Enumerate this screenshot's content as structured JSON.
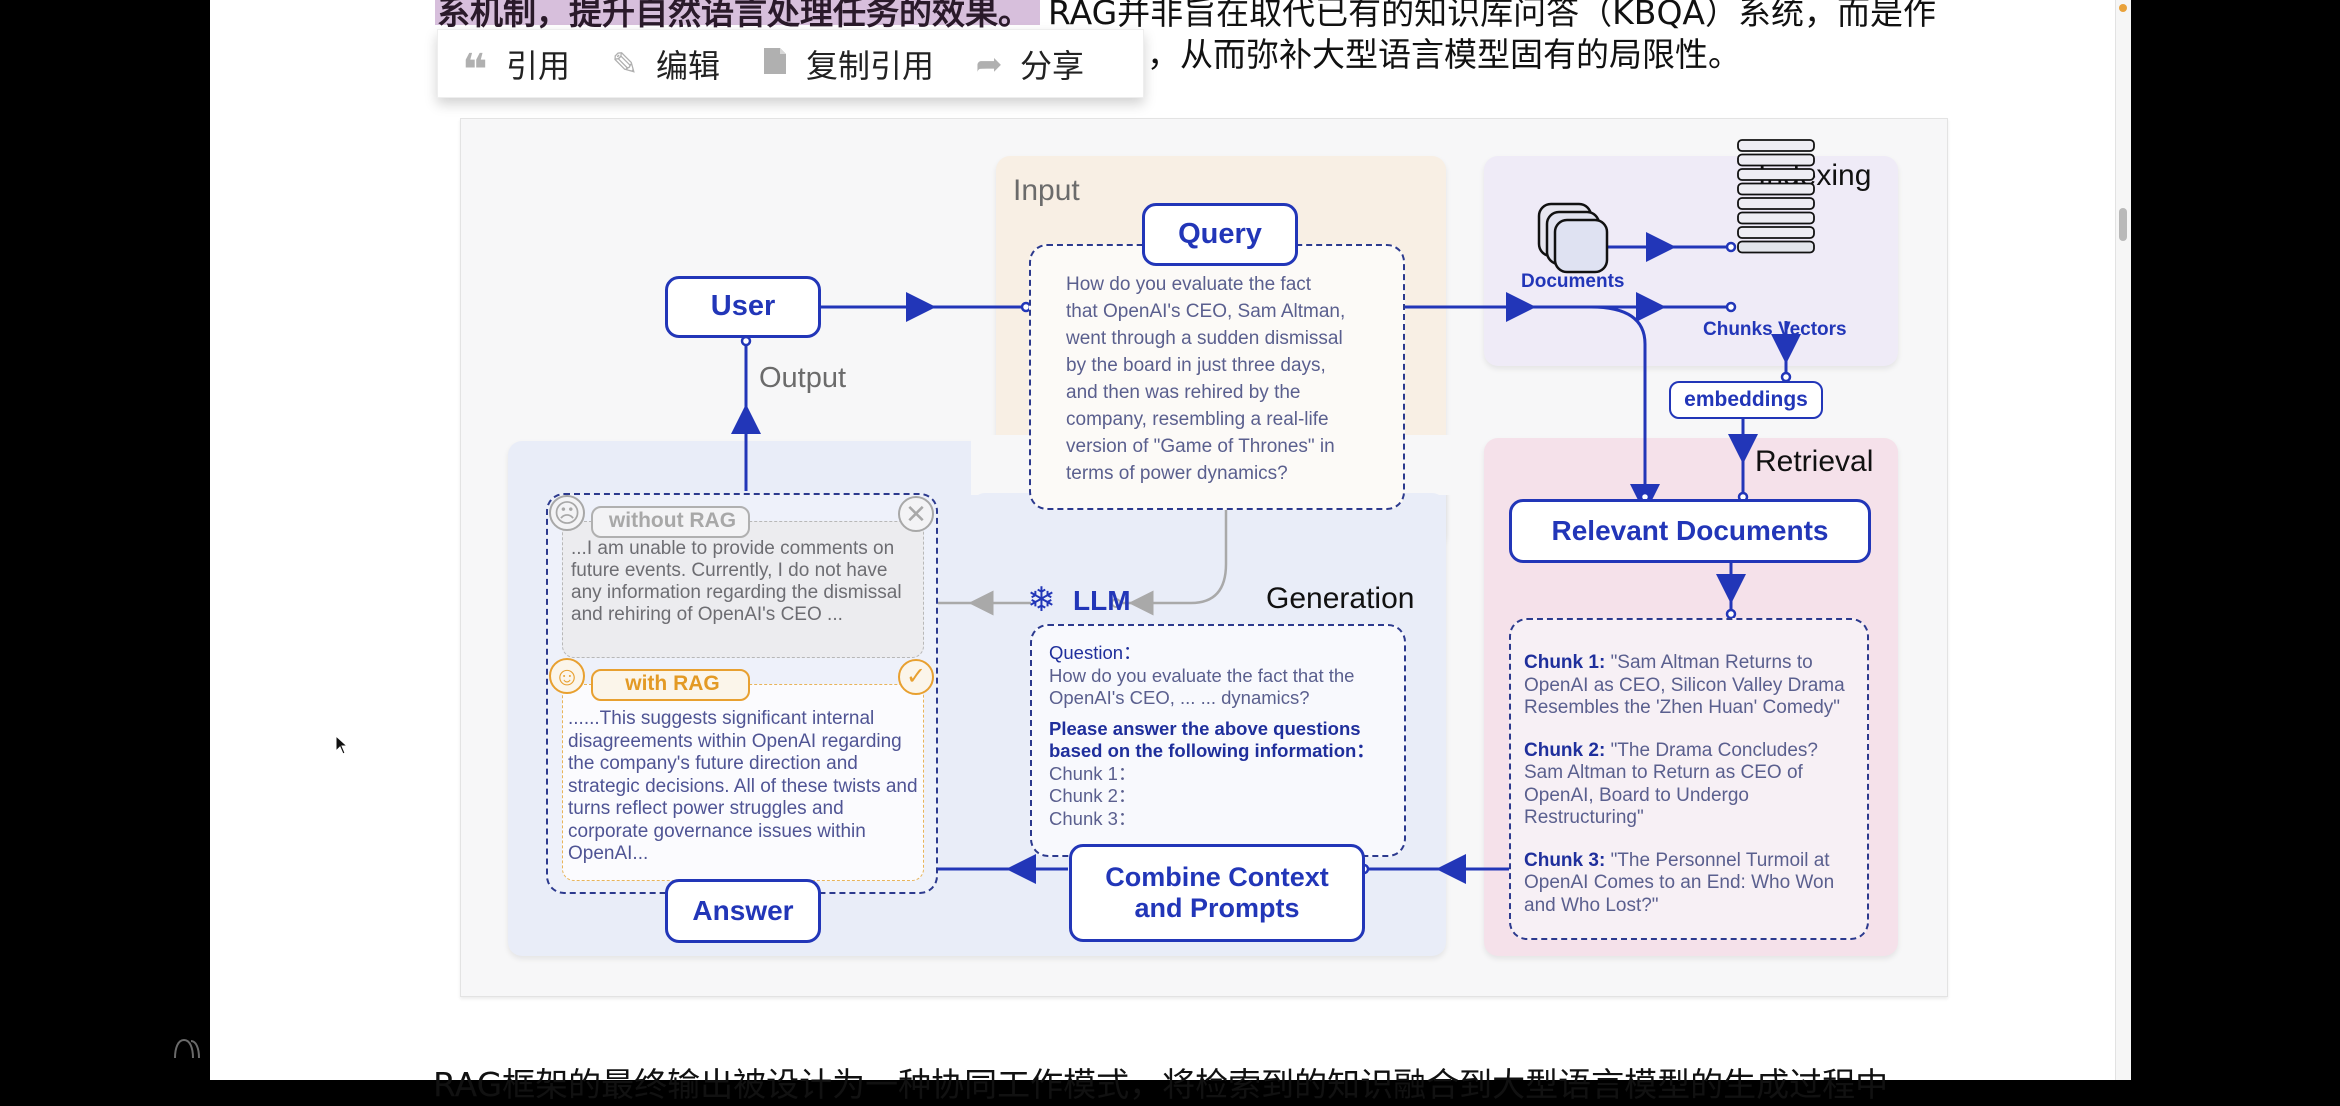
{
  "article": {
    "line1_highlighted": "系机制，提升自然语言处理任务的效果。",
    "line1_rest": "RAG并非旨在取代已有的知识库问答（KBQA）系统，而是作",
    "line2": "，从而弥补大型语言模型固有的局限性。",
    "bottom_line": "RAG框架的最终输出被设计为一种协同工作模式，将检索到的知识融合到大型语言模型的生成过程中"
  },
  "toolbar": {
    "items": [
      {
        "icon": "quote-icon",
        "glyph": "❝",
        "label": "引用"
      },
      {
        "icon": "pencil-icon",
        "glyph": "✎",
        "label": "编辑"
      },
      {
        "icon": "copy-icon",
        "glyph": "▮",
        "label": "复制引用"
      },
      {
        "icon": "share-icon",
        "glyph": "➦",
        "label": "分享"
      }
    ]
  },
  "diagram": {
    "user": "User",
    "output_label": "Output",
    "input": {
      "title": "Input",
      "query_label": "Query",
      "query_text": [
        "How do you evaluate the fact",
        "that OpenAI's CEO, Sam Altman,",
        "went through a sudden dismissal",
        "by the board in just three days,",
        "and then was rehired by the",
        "company, resembling a real-life",
        "version of \"Game of Thrones\" in",
        "terms of power dynamics?"
      ]
    },
    "indexing": {
      "title": "Indexing",
      "documents_label": "Documents",
      "chunks_label": "Chunks Vectors",
      "embeddings_label": "embeddings"
    },
    "retrieval": {
      "title": "Retrieval",
      "relevant_docs_label": "Relevant Documents",
      "chunks": [
        {
          "label": "Chunk 1:",
          "text": "\"Sam Altman Returns to OpenAI as CEO, Silicon Valley Drama Resembles the 'Zhen Huan' Comedy\""
        },
        {
          "label": "Chunk 2:",
          "text": "\"The Drama Concludes? Sam Altman to Return as CEO of OpenAI, Board to Undergo Restructuring\""
        },
        {
          "label": "Chunk 3:",
          "text": "\"The Personnel Turmoil at OpenAI Comes to an End: Who Won and Who Lost?\""
        }
      ]
    },
    "generation": {
      "title": "Generation",
      "llm_label": "LLM",
      "question_label": "Question：",
      "question_text": "How do you evaluate the fact that the OpenAI's CEO, ... ... dynamics?",
      "instruction": "Please answer the above questions based on the following information：",
      "chunk_lines": [
        "Chunk 1：",
        "Chunk 2：",
        "Chunk 3："
      ],
      "combine_label_1": "Combine Context",
      "combine_label_2": "and Prompts"
    },
    "output": {
      "without_rag_label": "without RAG",
      "without_rag_text": "...I am unable to provide comments on future events. Currently, I do not have any information regarding the dismissal and rehiring of OpenAI's CEO ...",
      "with_rag_label": "with RAG",
      "with_rag_text": "......This suggests significant internal disagreements within OpenAI regarding the company's future direction and strategic decisions. All of these twists and turns reflect power struggles and corporate governance issues within OpenAI...",
      "answer_label": "Answer"
    },
    "colors": {
      "accent_blue": "#2236b8",
      "input_panel": "#f8efe4",
      "indexing_panel": "#efebf7",
      "retrieval_panel": "#f5e1ea",
      "generation_panel": "#e9edf8",
      "with_rag": "#e8a030",
      "without_rag": "#a8a8a8"
    }
  }
}
